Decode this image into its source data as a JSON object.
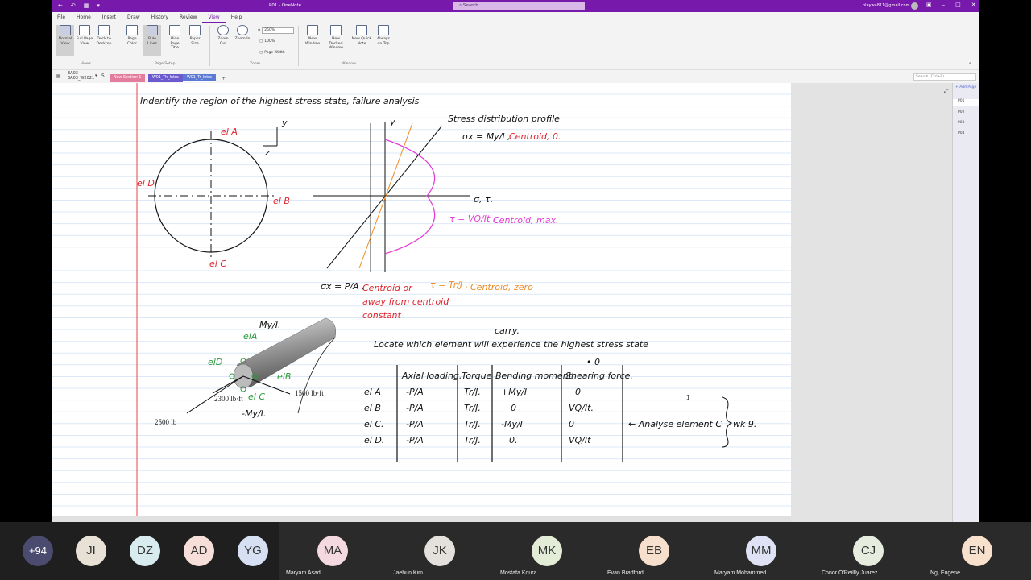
{
  "titlebar": {
    "title": "P01  -  OneNote",
    "search_placeholder": "Search",
    "user_email": "playwa811@gmail.com"
  },
  "menu": {
    "items": [
      "File",
      "Home",
      "Insert",
      "Draw",
      "History",
      "Review",
      "View",
      "Help"
    ],
    "active": "View"
  },
  "ribbon": {
    "buttons": [
      {
        "label": "Normal View"
      },
      {
        "label": "Full Page View"
      },
      {
        "label": "Dock to Desktop"
      },
      {
        "label": "Page Color"
      },
      {
        "label": "Rule Lines"
      },
      {
        "label": "Hide Page Title"
      },
      {
        "label": "Paper Size"
      },
      {
        "label": "Zoom Out"
      },
      {
        "label": "Zoom In"
      },
      {
        "label": "New Window"
      },
      {
        "label": "New Docked Window"
      },
      {
        "label": "New Quick Note"
      },
      {
        "label": "Always on Top"
      }
    ],
    "zoom_value": "250%",
    "zoom_100": "100%",
    "page_width": "Page Width",
    "groups": {
      "views": "Views",
      "page_setup": "Page Setup",
      "zoom": "Zoom",
      "window": "Window"
    }
  },
  "notebook": {
    "name": "3A03",
    "subtitle": "3A03_W2021",
    "count": "5",
    "tabs": [
      {
        "label": "New Section 1",
        "color": "#e47c9e"
      },
      {
        "label": "W01_Th_Intro",
        "color": "#6a5acd"
      },
      {
        "label": "W01_Tr_Intro",
        "color": "#5b7ad6"
      }
    ],
    "add_tab": "+",
    "search_placeholder": "Search (Ctrl+E)"
  },
  "pages_panel": {
    "add_page": "+ Add Page",
    "pages": [
      "P01",
      "P02",
      "P03",
      "P04"
    ],
    "selected": "P01"
  },
  "note": {
    "heading": "Indentify the region of the highest stress state, failure analysis",
    "circle_labels": {
      "A": "el A",
      "B": "el B",
      "C": "el C",
      "D": "el D",
      "y": "y",
      "z": "z"
    },
    "profile_title": "Stress distribution profile",
    "sigma_x": "σx = My/I ,",
    "sigma_x_note": "Centroid, 0.",
    "axis_y": "y",
    "axis_sig": "σ, τ.",
    "tau_vq": "τ = VQ/It ,",
    "tau_vq_note": "Centroid, max.",
    "tau_tr": "τ = Tr/J ,",
    "tau_tr_note": "Centroid, zero",
    "sigma_pa": "σx = P/A ,",
    "sigma_pa_note1": "Centroid or",
    "sigma_pa_note2": "away from centroid",
    "sigma_pa_note3": "constant",
    "shaft": {
      "my": "My/I.",
      "elA": "elA",
      "elD": "elD",
      "elB": "elB",
      "elC": "el C",
      "load_2300": "2300 lb·ft",
      "load_1500": "1500 lb·ft",
      "load_2500": "2500 lb",
      "neg_my": "-My/I."
    },
    "carry": "carry.",
    "locate": "Locate which element will experience the highest stress state",
    "table": {
      "headers": [
        "Axial loading.",
        "Torque",
        "Bending moment.",
        "Shearing force."
      ],
      "rows": [
        {
          "el": "el A",
          "cells": [
            "-P/A",
            "Tr/J.",
            "+My/I",
            "0"
          ]
        },
        {
          "el": "el B",
          "cells": [
            "-P/A",
            "Tr/J.",
            "0",
            "VQ/It."
          ]
        },
        {
          "el": "el C.",
          "cells": [
            "-P/A",
            "Tr/J.",
            "-My/I",
            "0"
          ]
        },
        {
          "el": "el D.",
          "cells": [
            "-P/A",
            "Tr/J.",
            "0.",
            "VQ/It"
          ]
        }
      ],
      "top_note": "• 0"
    },
    "analyse": "← Analyse element C",
    "wk": "wk 9."
  },
  "participants": {
    "overflow": "+94",
    "people": [
      {
        "initials": "JI",
        "name": "",
        "color": "#e8e2d6"
      },
      {
        "initials": "DZ",
        "name": "",
        "color": "#d8ecef"
      },
      {
        "initials": "AD",
        "name": "",
        "color": "#f6dfd8"
      },
      {
        "initials": "YG",
        "name": "",
        "color": "#d6e0f2"
      },
      {
        "initials": "MA",
        "name": "Maryam Asad",
        "color": "#f5d9e0"
      },
      {
        "initials": "JK",
        "name": "Jaehun Kim",
        "color": "#e4e0dc"
      },
      {
        "initials": "MK",
        "name": "Mostafa Koura",
        "color": "#e2ecd6"
      },
      {
        "initials": "EB",
        "name": "Evan Bradford",
        "color": "#f6dfcc"
      },
      {
        "initials": "MM",
        "name": "Maryam Mohammed",
        "color": "#dfe2f4"
      },
      {
        "initials": "CJ",
        "name": "Conor O'Reillly Juarez",
        "color": "#e6ecde"
      },
      {
        "initials": "EN",
        "name": "Ng, Eugene",
        "color": "#f7e0cc"
      }
    ]
  }
}
